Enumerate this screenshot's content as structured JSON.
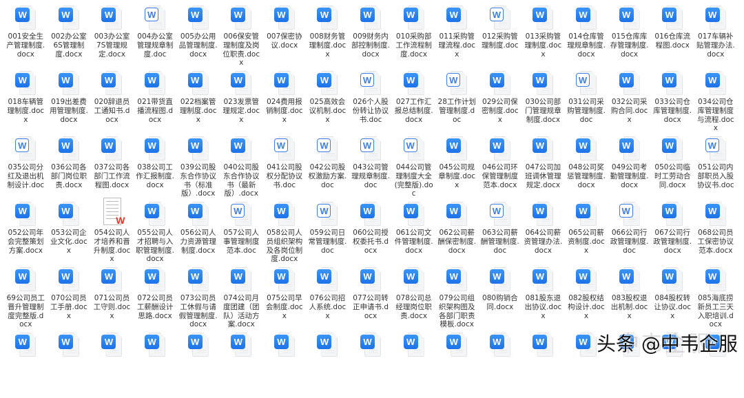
{
  "files": [
    {
      "name": "001安全生产管理制度.docx",
      "icon": "solid"
    },
    {
      "name": "002办公室6S管理制度.docx",
      "icon": "solid"
    },
    {
      "name": "003办公室7S管理规定.docx",
      "icon": "solid"
    },
    {
      "name": "004办公室管理规章制度.doc",
      "icon": "outline"
    },
    {
      "name": "005办公用品管理制度.docx",
      "icon": "solid"
    },
    {
      "name": "006保安管理制度及岗位职责.docx",
      "icon": "solid"
    },
    {
      "name": "007保密协议.docx",
      "icon": "solid"
    },
    {
      "name": "008财务管理制度.docx",
      "icon": "solid"
    },
    {
      "name": "009财务内部控制制度.docx",
      "icon": "solid"
    },
    {
      "name": "010采购部工作流程制度.docx",
      "icon": "solid"
    },
    {
      "name": "011采购管理流程.docx",
      "icon": "solid"
    },
    {
      "name": "012采购管理制度.doc",
      "icon": "outline"
    },
    {
      "name": "013采购管理制度.docx",
      "icon": "solid"
    },
    {
      "name": "014仓库管理规章制度.docx",
      "icon": "solid"
    },
    {
      "name": "015仓库库存管理制度.docx",
      "icon": "solid"
    },
    {
      "name": "016仓库流程图.docx",
      "icon": "solid"
    },
    {
      "name": "017车辆补贴管理办法.docx",
      "icon": "solid"
    },
    {
      "name": "018车辆管理制度.docx",
      "icon": "solid"
    },
    {
      "name": "019出差费用管理制度.docx",
      "icon": "solid"
    },
    {
      "name": "020辞退员工通知书.docx",
      "icon": "solid"
    },
    {
      "name": "021带货直播流程图.docx",
      "icon": "solid"
    },
    {
      "name": "022档案管理制度.docx",
      "icon": "solid"
    },
    {
      "name": "023发票管理规定.docx",
      "icon": "solid"
    },
    {
      "name": "024费用报销制度.docx",
      "icon": "solid"
    },
    {
      "name": "025高效会议机制.docx",
      "icon": "solid"
    },
    {
      "name": "026个人股份转让协议书.doc",
      "icon": "outline"
    },
    {
      "name": "027工作汇报总结制度.docx",
      "icon": "solid"
    },
    {
      "name": "28工作计划管理制度.doc",
      "icon": "outline"
    },
    {
      "name": "029公司保密制度.docx",
      "icon": "solid"
    },
    {
      "name": "030公司部门管理规章制度.docx",
      "icon": "solid"
    },
    {
      "name": "031公司采购管理制度.doc",
      "icon": "outline"
    },
    {
      "name": "032公司采购合同.docx",
      "icon": "solid"
    },
    {
      "name": "033公司仓库管理制度.docx",
      "icon": "solid"
    },
    {
      "name": "034公司仓库管理制度与流程.docx",
      "icon": "solid"
    },
    {
      "name": "035公司分红及退出机制设计.doc",
      "icon": "outline"
    },
    {
      "name": "036公司各部门岗位职责.docx",
      "icon": "solid"
    },
    {
      "name": "037公司各部门工作流程图.docx",
      "icon": "solid"
    },
    {
      "name": "038公司工作汇报制度.docx",
      "icon": "solid"
    },
    {
      "name": "039公司股东合作协议书（标准版）.docx",
      "icon": "solid"
    },
    {
      "name": "040公司股东合作协议书（最新版）.docx",
      "icon": "solid"
    },
    {
      "name": "041公司股权分配协议书.doc",
      "icon": "outline"
    },
    {
      "name": "042公司股权激励方案.doc",
      "icon": "outline"
    },
    {
      "name": "043公司管理规章制度.doc",
      "icon": "outline"
    },
    {
      "name": "044公司管理制度大全(完整版).doc",
      "icon": "outline"
    },
    {
      "name": "045公司规章制度.docx",
      "icon": "solid"
    },
    {
      "name": "046公司环保管理制度范本.docx",
      "icon": "solid"
    },
    {
      "name": "047公司加班调休管理规定.docx",
      "icon": "solid"
    },
    {
      "name": "048公司奖惩管理制度.docx",
      "icon": "solid"
    },
    {
      "name": "049公司考勤管理制度.docx",
      "icon": "solid"
    },
    {
      "name": "050公司临时工劳动合同.docx",
      "icon": "solid"
    },
    {
      "name": "051公司内部职员入股协议书.doc",
      "icon": "outline"
    },
    {
      "name": "052公司年会完整策划方案.docx",
      "icon": "solid"
    },
    {
      "name": "053公司企业文化.docx",
      "icon": "solid"
    },
    {
      "name": "054公司人才培养和晋升制度.docx",
      "icon": "thumb"
    },
    {
      "name": "055公司人才招聘与入职管理制度.docx",
      "icon": "solid"
    },
    {
      "name": "056公司人力资源管理制度.docx",
      "icon": "solid"
    },
    {
      "name": "057公司人事管理制度范本.doc",
      "icon": "outline"
    },
    {
      "name": "058公司人员组织架构及各岗位制度.docx",
      "icon": "solid"
    },
    {
      "name": "059公司日常管理制度.doc",
      "icon": "outline"
    },
    {
      "name": "060公司授权委托书.docx",
      "icon": "solid"
    },
    {
      "name": "061公司文件管理制度.docx",
      "icon": "solid"
    },
    {
      "name": "062公司薪酬保密制度.docx",
      "icon": "solid"
    },
    {
      "name": "063公司薪酬管理制度.doc",
      "icon": "outline"
    },
    {
      "name": "064公司薪资管理办法.docx",
      "icon": "solid"
    },
    {
      "name": "065公司薪资制度.docx",
      "icon": "solid"
    },
    {
      "name": "066公司行政管理制度.doc",
      "icon": "outline"
    },
    {
      "name": "067公司行政管理制度.docx",
      "icon": "solid"
    },
    {
      "name": "068公司员工保密协议范本.docx",
      "icon": "solid"
    },
    {
      "name": "69公司员工晋升管理制度完整版.docx",
      "icon": "solid"
    },
    {
      "name": "070公司员工手册.docx",
      "icon": "solid"
    },
    {
      "name": "071公司员工守则.docx",
      "icon": "solid"
    },
    {
      "name": "072公司员工薪酬设计思路.docx",
      "icon": "solid"
    },
    {
      "name": "073公司员工休假与请假管理制度.docx",
      "icon": "solid"
    },
    {
      "name": "074公司月度团建（团队）活动方案.docx",
      "icon": "solid"
    },
    {
      "name": "075公司早会制度.docx",
      "icon": "solid"
    },
    {
      "name": "076公司招人系统.docx",
      "icon": "solid"
    },
    {
      "name": "077公司转正申请书.docx",
      "icon": "solid"
    },
    {
      "name": "078公司总经理岗位职责.docx",
      "icon": "solid"
    },
    {
      "name": "079公司组织架构图及各部门职责模板.docx",
      "icon": "solid"
    },
    {
      "name": "080购销合同.docx",
      "icon": "solid"
    },
    {
      "name": "081股东退出协议.docx",
      "icon": "solid"
    },
    {
      "name": "082股权结构设计.docx",
      "icon": "solid"
    },
    {
      "name": "083股权退出机制.docx",
      "icon": "solid"
    },
    {
      "name": "084股权转让协议.docx",
      "icon": "solid"
    },
    {
      "name": "085海底捞新员工三天入职培训.docx",
      "icon": "solid"
    }
  ],
  "partial_row_icons": [
    "solid",
    "solid",
    "solid",
    "solid",
    "solid",
    "solid",
    "solid",
    "solid",
    "solid",
    "solid",
    "solid",
    "solid",
    "solid",
    "solid",
    "solid",
    "solid",
    "solid"
  ],
  "icon_letter": "W",
  "watermark": {
    "faint": "中韦企服",
    "main": "头条 @中韦企服"
  },
  "colors": {
    "accent": "#1d72e8",
    "text": "#333333"
  }
}
